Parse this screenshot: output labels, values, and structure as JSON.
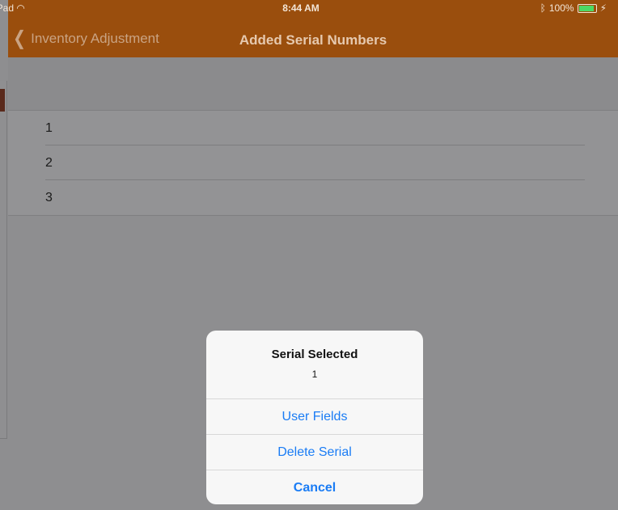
{
  "status_bar": {
    "device": "iPad",
    "wifi_icon": "wifi-icon",
    "time": "8:44 AM",
    "bluetooth_icon": "bluetooth-icon",
    "battery_percent": "100%",
    "battery_level": 1.0,
    "charging_icon": "bolt-icon"
  },
  "navbar": {
    "back_label": "Inventory Adjustment",
    "title": "Added Serial Numbers",
    "color": "#9a4e0d"
  },
  "serials": [
    {
      "label": "1"
    },
    {
      "label": "2"
    },
    {
      "label": "3"
    }
  ],
  "action_sheet": {
    "title": "Serial Selected",
    "message": "1",
    "buttons": [
      {
        "label": "User Fields"
      },
      {
        "label": "Delete Serial"
      },
      {
        "label": "Cancel"
      }
    ],
    "button_color": "#1a7cf5"
  }
}
